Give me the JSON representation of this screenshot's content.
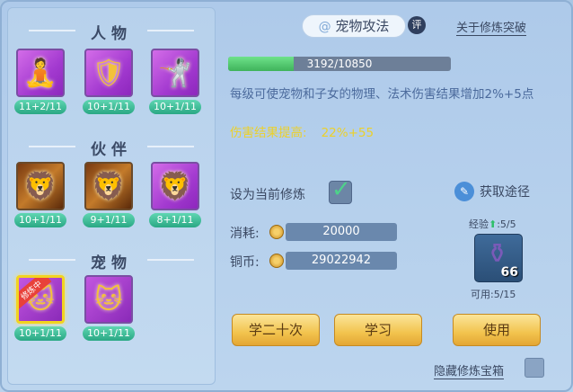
{
  "left": {
    "sections": [
      {
        "title": "人物",
        "cards": [
          {
            "level": "11+2/11"
          },
          {
            "level": "10+1/11"
          },
          {
            "level": "10+1/11"
          }
        ]
      },
      {
        "title": "伙伴",
        "cards": [
          {
            "level": "10+1/11"
          },
          {
            "level": "9+1/11"
          },
          {
            "level": "8+1/11"
          }
        ]
      },
      {
        "title": "宠物",
        "cards": [
          {
            "level": "10+1/11",
            "ribbon": "修炼中"
          },
          {
            "level": "10+1/11"
          }
        ]
      }
    ]
  },
  "right": {
    "tab_title": "宠物攻法",
    "eval_badge": "评",
    "breakthrough_link": "关于修炼突破",
    "progress": {
      "text": "3192/10850",
      "current": 3192,
      "max": 10850
    },
    "description": "每级可使宠物和子女的物理、法术伤害结果增加2%+5点",
    "bonus_label": "伤害结果提高:",
    "bonus_value": "22%+55",
    "set_current_label": "设为当前修炼",
    "get_way_label": "获取途径",
    "cost_label": "消耗:",
    "cost_value": "20000",
    "copper_label": "铜币:",
    "copper_value": "29022942",
    "exp_label": "经验",
    "exp_value": ":5/5",
    "item_count": "66",
    "usable_label": "可用:5/15",
    "buttons": {
      "learn20": "学二十次",
      "learn": "学习",
      "use": "使用"
    },
    "hide_box_label": "隐藏修炼宝箱"
  }
}
